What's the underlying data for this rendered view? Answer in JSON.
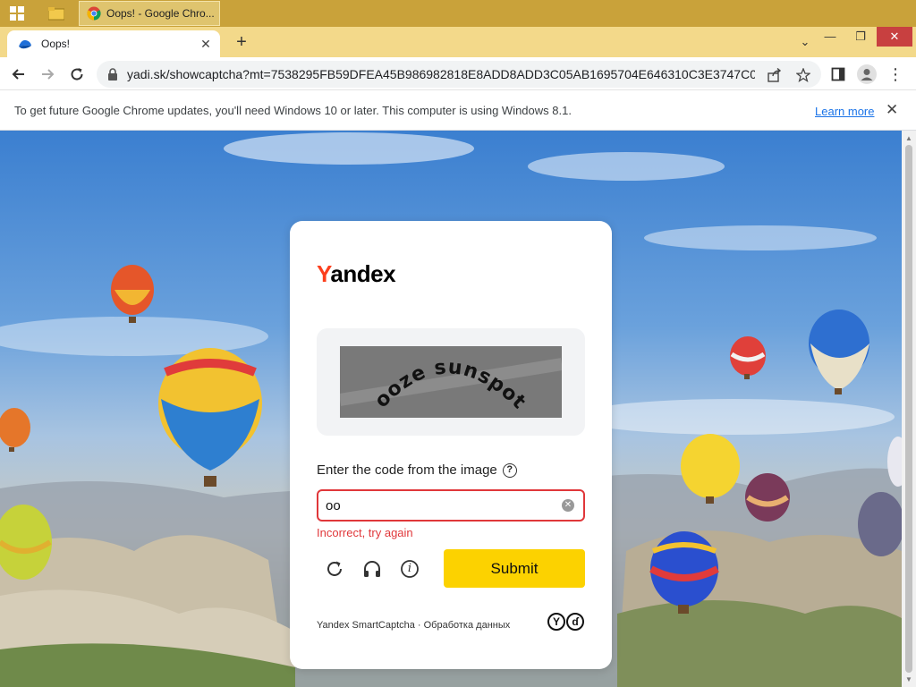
{
  "taskbar": {
    "task_title": "Oops! - Google Chro..."
  },
  "tab": {
    "title": "Oops!",
    "close": "✕",
    "new_tab": "+"
  },
  "window": {
    "min": "—",
    "max": "❐",
    "close": "✕",
    "tab_search": "⌄"
  },
  "toolbar": {
    "url": "yadi.sk/showcaptcha?mt=7538295FB59DFEA45B986982818E8ADD8ADD3C05AB1695704E646310C3E3747C091...",
    "menu": "⋮"
  },
  "infobar": {
    "text": "To get future Google Chrome updates, you'll need Windows 10 or later. This computer is using Windows 8.1.",
    "link": "Learn more",
    "close": "✕"
  },
  "captcha": {
    "logo_first": "Y",
    "logo_rest": "andex",
    "captcha_text": "ooze sunspot",
    "prompt": "Enter the code from the image",
    "help": "?",
    "input_value": "oo",
    "clear": "✕",
    "error": "Incorrect, try again",
    "submit": "Submit",
    "info": "i",
    "footer": "Yandex SmartCaptcha · Обработка данных",
    "footer_logo": [
      "Y",
      "ɗ"
    ]
  },
  "colors": {
    "accent_yellow": "#fcd200",
    "error_red": "#e0373a",
    "brand_red": "#fc3f1d",
    "link_blue": "#1a73e8"
  }
}
